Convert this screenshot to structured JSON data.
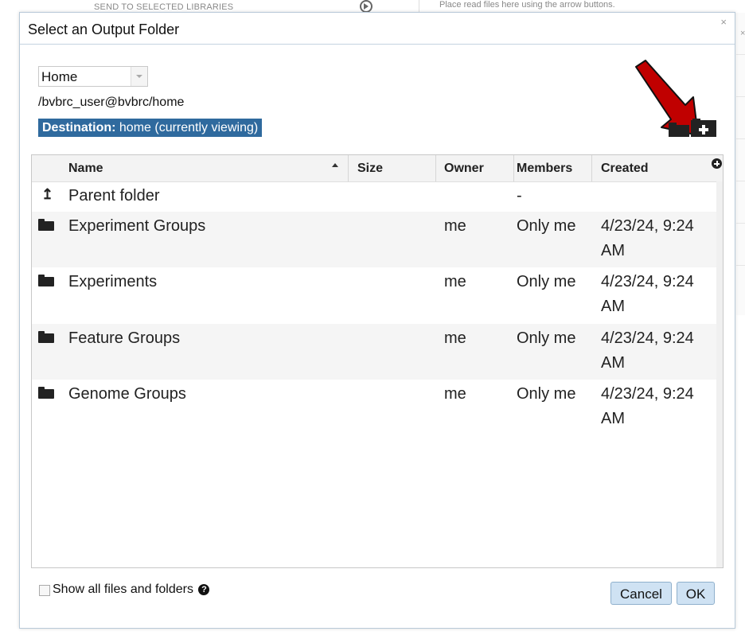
{
  "background": {
    "send_libraries": "SEND TO SELECTED LIBRARIES",
    "place_hint": "Place read files here using the arrow buttons."
  },
  "dialog": {
    "title": "Select an Output Folder",
    "close_glyph": "×",
    "folder_select": {
      "value": "Home"
    },
    "path": "/bvbrc_user@bvbrc/home",
    "destination": {
      "label": "Destination:",
      "value": "home (currently viewing)"
    }
  },
  "grid": {
    "columns": [
      "Name",
      "Size",
      "Owner",
      "Members",
      "Created"
    ],
    "rows": [
      {
        "icon": "parent-folder-icon",
        "name": "Parent folder",
        "size": "",
        "owner": "",
        "members": "-",
        "created_line1": "",
        "created_line2": ""
      },
      {
        "icon": "folder-icon",
        "name": "Experiment Groups",
        "size": "",
        "owner": "me",
        "members": "Only me",
        "created_line1": "4/23/24, 9:24",
        "created_line2": "AM"
      },
      {
        "icon": "folder-icon",
        "name": "Experiments",
        "size": "",
        "owner": "me",
        "members": "Only me",
        "created_line1": "4/23/24, 9:24",
        "created_line2": "AM"
      },
      {
        "icon": "folder-icon",
        "name": "Feature Groups",
        "size": "",
        "owner": "me",
        "members": "Only me",
        "created_line1": "4/23/24, 9:24",
        "created_line2": "AM"
      },
      {
        "icon": "folder-icon",
        "name": "Genome Groups",
        "size": "",
        "owner": "me",
        "members": "Only me",
        "created_line1": "4/23/24, 9:24",
        "created_line2": "AM"
      }
    ]
  },
  "footer": {
    "show_all_label": "Show all files and folders",
    "help_glyph": "?",
    "cancel_label": "Cancel",
    "ok_label": "OK"
  },
  "colors": {
    "destination_bg": "#2f6a9e",
    "button_bg": "#cfe2f3",
    "annotation_arrow": "#c00000"
  }
}
